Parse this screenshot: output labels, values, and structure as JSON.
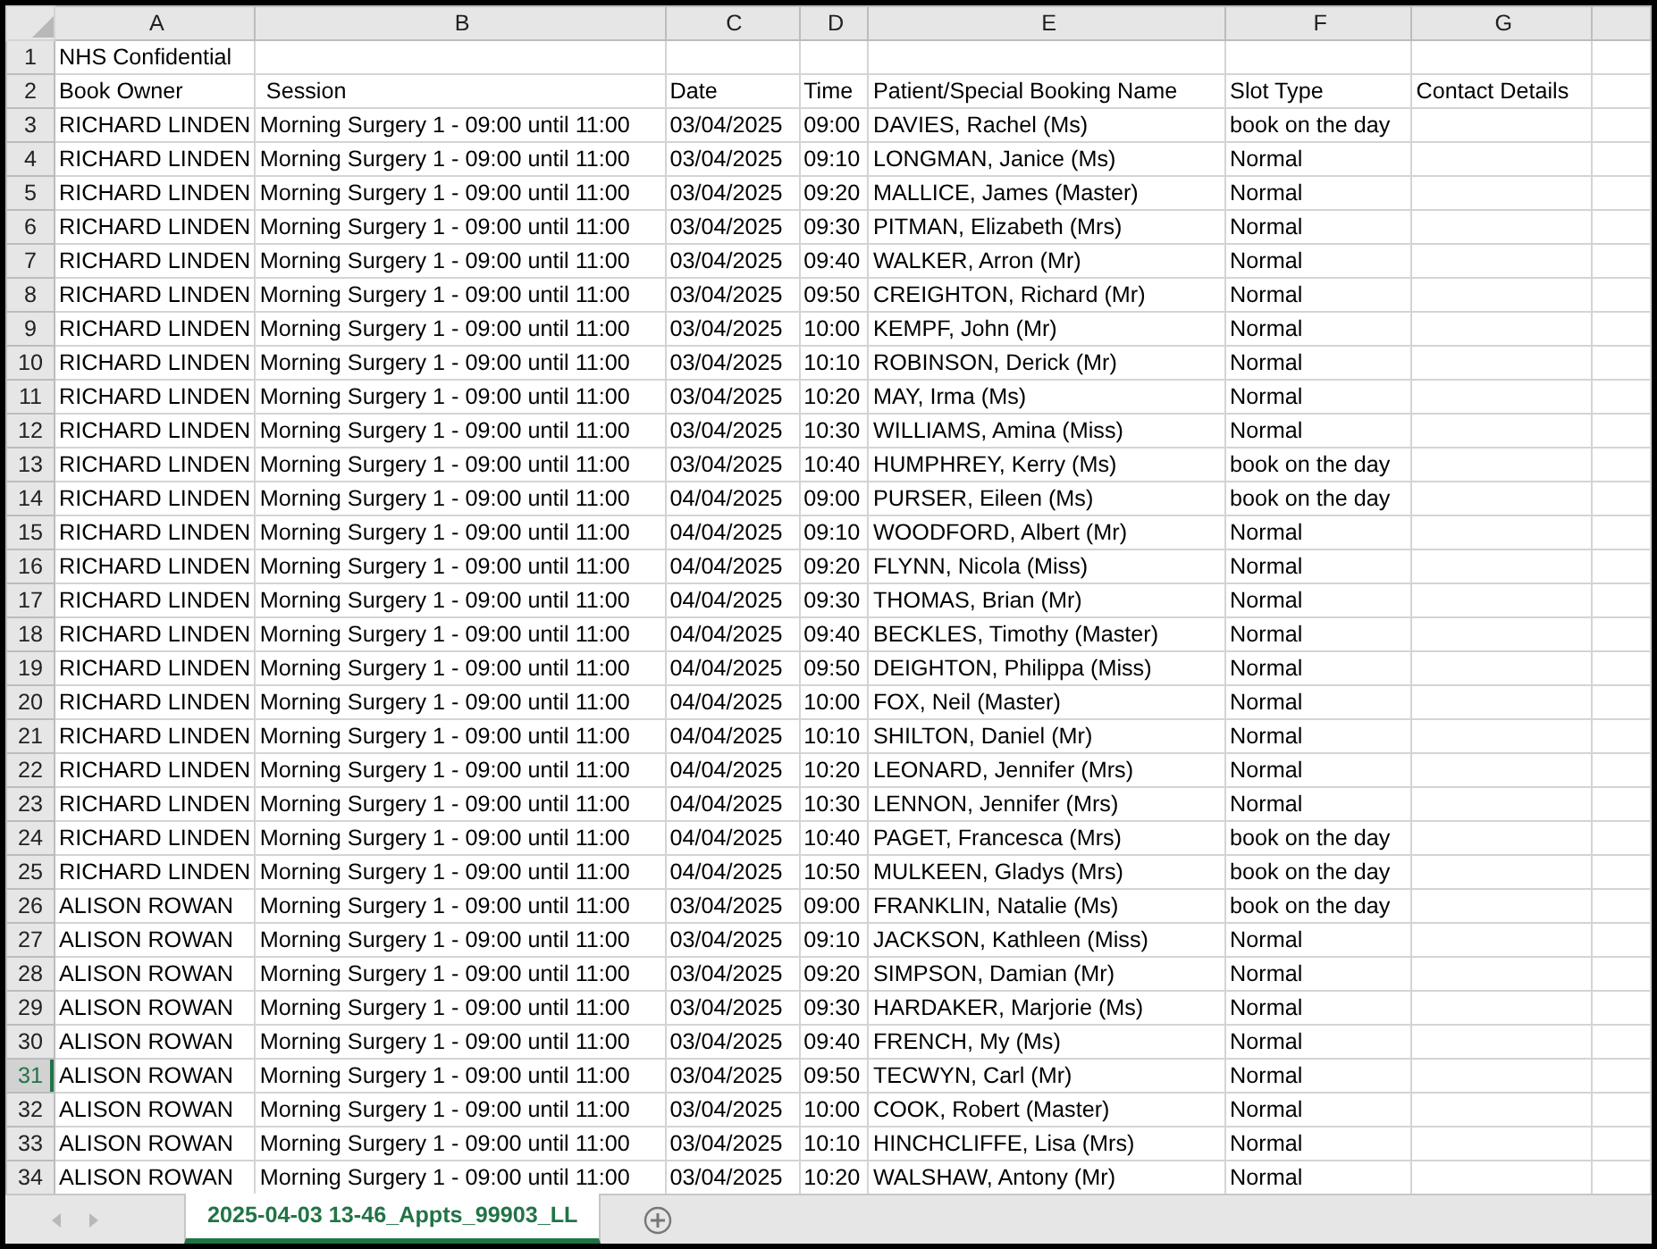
{
  "columns": [
    "A",
    "B",
    "C",
    "D",
    "E",
    "F",
    "G"
  ],
  "rows": [
    {
      "number": "1",
      "selected": false,
      "cells": [
        "NHS Confidential",
        null,
        null,
        null,
        null,
        null,
        null
      ]
    },
    {
      "number": "2",
      "selected": false,
      "cells": [
        "Book Owner",
        " Session",
        "Date",
        "Time",
        "Patient/Special Booking Name",
        "Slot Type",
        "Contact Details"
      ]
    },
    {
      "number": "3",
      "selected": false,
      "cells": [
        "RICHARD LINDEN",
        "Morning Surgery 1 - 09:00 until 11:00",
        "03/04/2025",
        "09:00",
        "DAVIES, Rachel (Ms)",
        "book on the day",
        null
      ]
    },
    {
      "number": "4",
      "selected": false,
      "cells": [
        "RICHARD LINDEN",
        "Morning Surgery 1 - 09:00 until 11:00",
        "03/04/2025",
        "09:10",
        "LONGMAN, Janice (Ms)",
        "Normal",
        null
      ]
    },
    {
      "number": "5",
      "selected": false,
      "cells": [
        "RICHARD LINDEN",
        "Morning Surgery 1 - 09:00 until 11:00",
        "03/04/2025",
        "09:20",
        "MALLICE, James (Master)",
        "Normal",
        null
      ]
    },
    {
      "number": "6",
      "selected": false,
      "cells": [
        "RICHARD LINDEN",
        "Morning Surgery 1 - 09:00 until 11:00",
        "03/04/2025",
        "09:30",
        "PITMAN, Elizabeth (Mrs)",
        "Normal",
        null
      ]
    },
    {
      "number": "7",
      "selected": false,
      "cells": [
        "RICHARD LINDEN",
        "Morning Surgery 1 - 09:00 until 11:00",
        "03/04/2025",
        "09:40",
        "WALKER, Arron (Mr)",
        "Normal",
        null
      ]
    },
    {
      "number": "8",
      "selected": false,
      "cells": [
        "RICHARD LINDEN",
        "Morning Surgery 1 - 09:00 until 11:00",
        "03/04/2025",
        "09:50",
        "CREIGHTON, Richard (Mr)",
        "Normal",
        null
      ]
    },
    {
      "number": "9",
      "selected": false,
      "cells": [
        "RICHARD LINDEN",
        "Morning Surgery 1 - 09:00 until 11:00",
        "03/04/2025",
        "10:00",
        "KEMPF, John (Mr)",
        "Normal",
        null
      ]
    },
    {
      "number": "10",
      "selected": false,
      "cells": [
        "RICHARD LINDEN",
        "Morning Surgery 1 - 09:00 until 11:00",
        "03/04/2025",
        "10:10",
        "ROBINSON, Derick (Mr)",
        "Normal",
        null
      ]
    },
    {
      "number": "11",
      "selected": false,
      "cells": [
        "RICHARD LINDEN",
        "Morning Surgery 1 - 09:00 until 11:00",
        "03/04/2025",
        "10:20",
        "MAY, Irma (Ms)",
        "Normal",
        null
      ]
    },
    {
      "number": "12",
      "selected": false,
      "cells": [
        "RICHARD LINDEN",
        "Morning Surgery 1 - 09:00 until 11:00",
        "03/04/2025",
        "10:30",
        "WILLIAMS, Amina (Miss)",
        "Normal",
        null
      ]
    },
    {
      "number": "13",
      "selected": false,
      "cells": [
        "RICHARD LINDEN",
        "Morning Surgery 1 - 09:00 until 11:00",
        "03/04/2025",
        "10:40",
        "HUMPHREY, Kerry (Ms)",
        "book on the day",
        null
      ]
    },
    {
      "number": "14",
      "selected": false,
      "cells": [
        "RICHARD LINDEN",
        "Morning Surgery 1 - 09:00 until 11:00",
        "04/04/2025",
        "09:00",
        "PURSER, Eileen (Ms)",
        "book on the day",
        null
      ]
    },
    {
      "number": "15",
      "selected": false,
      "cells": [
        "RICHARD LINDEN",
        "Morning Surgery 1 - 09:00 until 11:00",
        "04/04/2025",
        "09:10",
        "WOODFORD, Albert (Mr)",
        "Normal",
        null
      ]
    },
    {
      "number": "16",
      "selected": false,
      "cells": [
        "RICHARD LINDEN",
        "Morning Surgery 1 - 09:00 until 11:00",
        "04/04/2025",
        "09:20",
        "FLYNN, Nicola (Miss)",
        "Normal",
        null
      ]
    },
    {
      "number": "17",
      "selected": false,
      "cells": [
        "RICHARD LINDEN",
        "Morning Surgery 1 - 09:00 until 11:00",
        "04/04/2025",
        "09:30",
        "THOMAS, Brian (Mr)",
        "Normal",
        null
      ]
    },
    {
      "number": "18",
      "selected": false,
      "cells": [
        "RICHARD LINDEN",
        "Morning Surgery 1 - 09:00 until 11:00",
        "04/04/2025",
        "09:40",
        "BECKLES, Timothy (Master)",
        "Normal",
        null
      ]
    },
    {
      "number": "19",
      "selected": false,
      "cells": [
        "RICHARD LINDEN",
        "Morning Surgery 1 - 09:00 until 11:00",
        "04/04/2025",
        "09:50",
        "DEIGHTON, Philippa (Miss)",
        "Normal",
        null
      ]
    },
    {
      "number": "20",
      "selected": false,
      "cells": [
        "RICHARD LINDEN",
        "Morning Surgery 1 - 09:00 until 11:00",
        "04/04/2025",
        "10:00",
        "FOX, Neil (Master)",
        "Normal",
        null
      ]
    },
    {
      "number": "21",
      "selected": false,
      "cells": [
        "RICHARD LINDEN",
        "Morning Surgery 1 - 09:00 until 11:00",
        "04/04/2025",
        "10:10",
        "SHILTON, Daniel (Mr)",
        "Normal",
        null
      ]
    },
    {
      "number": "22",
      "selected": false,
      "cells": [
        "RICHARD LINDEN",
        "Morning Surgery 1 - 09:00 until 11:00",
        "04/04/2025",
        "10:20",
        "LEONARD, Jennifer (Mrs)",
        "Normal",
        null
      ]
    },
    {
      "number": "23",
      "selected": false,
      "cells": [
        "RICHARD LINDEN",
        "Morning Surgery 1 - 09:00 until 11:00",
        "04/04/2025",
        "10:30",
        "LENNON, Jennifer (Mrs)",
        "Normal",
        null
      ]
    },
    {
      "number": "24",
      "selected": false,
      "cells": [
        "RICHARD LINDEN",
        "Morning Surgery 1 - 09:00 until 11:00",
        "04/04/2025",
        "10:40",
        "PAGET, Francesca (Mrs)",
        "book on the day",
        null
      ]
    },
    {
      "number": "25",
      "selected": false,
      "cells": [
        "RICHARD LINDEN",
        "Morning Surgery 1 - 09:00 until 11:00",
        "04/04/2025",
        "10:50",
        "MULKEEN, Gladys (Mrs)",
        "book on the day",
        null
      ]
    },
    {
      "number": "26",
      "selected": false,
      "cells": [
        "ALISON ROWAN",
        "Morning Surgery 1 - 09:00 until 11:00",
        "03/04/2025",
        "09:00",
        "FRANKLIN, Natalie (Ms)",
        "book on the day",
        null
      ]
    },
    {
      "number": "27",
      "selected": false,
      "cells": [
        "ALISON ROWAN",
        "Morning Surgery 1 - 09:00 until 11:00",
        "03/04/2025",
        "09:10",
        "JACKSON, Kathleen (Miss)",
        "Normal",
        null
      ]
    },
    {
      "number": "28",
      "selected": false,
      "cells": [
        "ALISON ROWAN",
        "Morning Surgery 1 - 09:00 until 11:00",
        "03/04/2025",
        "09:20",
        "SIMPSON, Damian (Mr)",
        "Normal",
        null
      ]
    },
    {
      "number": "29",
      "selected": false,
      "cells": [
        "ALISON ROWAN",
        "Morning Surgery 1 - 09:00 until 11:00",
        "03/04/2025",
        "09:30",
        "HARDAKER, Marjorie (Ms)",
        "Normal",
        null
      ]
    },
    {
      "number": "30",
      "selected": false,
      "cells": [
        "ALISON ROWAN",
        "Morning Surgery 1 - 09:00 until 11:00",
        "03/04/2025",
        "09:40",
        "FRENCH, My (Ms)",
        "Normal",
        null
      ]
    },
    {
      "number": "31",
      "selected": true,
      "cells": [
        "ALISON ROWAN",
        "Morning Surgery 1 - 09:00 until 11:00",
        "03/04/2025",
        "09:50",
        "TECWYN, Carl (Mr)",
        "Normal",
        null
      ]
    },
    {
      "number": "32",
      "selected": false,
      "cells": [
        "ALISON ROWAN",
        "Morning Surgery 1 - 09:00 until 11:00",
        "03/04/2025",
        "10:00",
        "COOK, Robert (Master)",
        "Normal",
        null
      ]
    },
    {
      "number": "33",
      "selected": false,
      "cells": [
        "ALISON ROWAN",
        "Morning Surgery 1 - 09:00 until 11:00",
        "03/04/2025",
        "10:10",
        "HINCHCLIFFE, Lisa (Mrs)",
        "Normal",
        null
      ]
    },
    {
      "number": "34",
      "selected": false,
      "cells": [
        "ALISON ROWAN",
        "Morning Surgery 1 - 09:00 until 11:00",
        "03/04/2025",
        "10:20",
        "WALSHAW, Antony (Mr)",
        "Normal",
        null
      ]
    }
  ],
  "sheet_tabs": [
    {
      "label": "2025-04-03 13-46_Appts_99903_LL",
      "selected": true
    }
  ]
}
